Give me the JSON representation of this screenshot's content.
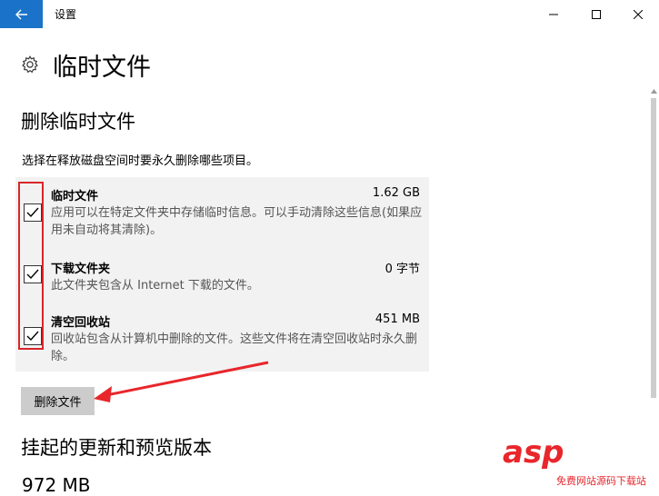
{
  "window": {
    "title": "设置",
    "back_icon": "arrow-left-icon",
    "controls": [
      "minimize-icon",
      "maximize-icon",
      "close-icon"
    ],
    "accent_color": "#1a73c8"
  },
  "page": {
    "icon": "gear-icon",
    "title": "临时文件"
  },
  "delete_section": {
    "title": "删除临时文件",
    "subtitle": "选择在释放磁盘空间时要永久删除哪些项目。",
    "items": [
      {
        "name": "临时文件",
        "size": "1.62 GB",
        "description": "应用可以在特定文件夹中存储临时信息。可以手动清除这些信息(如果应用未自动将其清除)。",
        "checked": true
      },
      {
        "name": "下载文件夹",
        "size": "0 字节",
        "description": "此文件夹包含从 Internet 下载的文件。",
        "checked": true
      },
      {
        "name": "清空回收站",
        "size": "451 MB",
        "description": "回收站包含从计算机中删除的文件。这些文件将在清空回收站时永久删除。",
        "checked": true
      }
    ],
    "delete_button": "删除文件"
  },
  "pending_section": {
    "title": "挂起的更新和预览版本",
    "size": "972 MB"
  },
  "annotation_color": "#d9262b",
  "watermark": {
    "logo": "asp",
    "text": "免费网站源码下载站"
  }
}
